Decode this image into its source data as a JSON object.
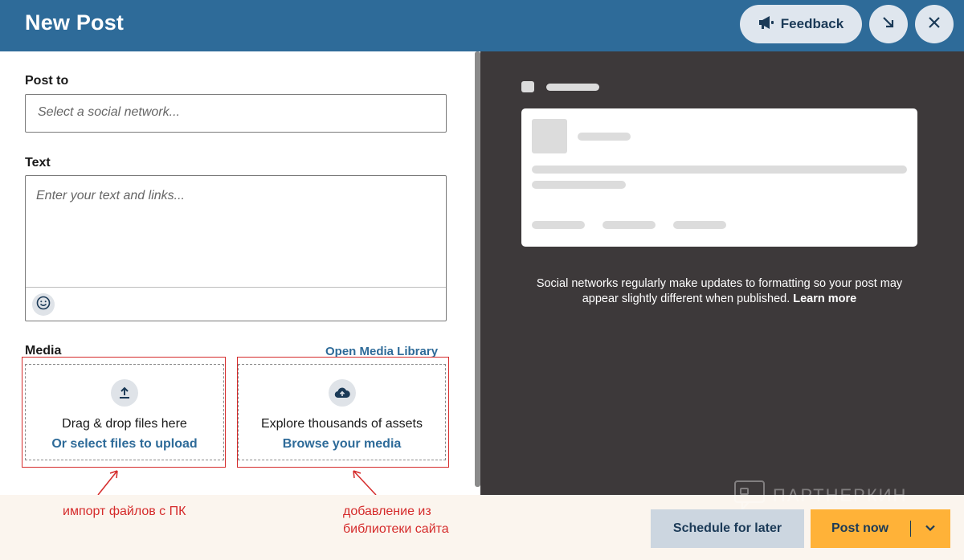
{
  "header": {
    "title": "New Post",
    "feedback_label": "Feedback",
    "bg_color": "#2e6b99"
  },
  "compose": {
    "post_to_label": "Post to",
    "network_placeholder": "Select a social network...",
    "text_label": "Text",
    "text_placeholder": "Enter your text and links...",
    "media_label": "Media",
    "media_library_link": "Open Media Library",
    "upload_zone": {
      "text": "Drag & drop files here",
      "link": "Or select files to upload",
      "icon": "upload-icon"
    },
    "browse_zone": {
      "text": "Explore thousands of assets",
      "link": "Browse your media",
      "icon": "cloud-upload-icon"
    }
  },
  "annotations": {
    "left_note": "импорт файлов с ПК",
    "right_note_line1": "добавление из",
    "right_note_line2": "библиотеки сайта",
    "color": "#d52b2b"
  },
  "preview": {
    "note_text": "Social networks regularly make updates to formatting so your post may appear slightly different when published.",
    "learn_more": "Learn more"
  },
  "footer": {
    "schedule_label": "Schedule for later",
    "post_now_label": "Post now",
    "accent_color": "#ffb238"
  },
  "watermark": {
    "text": "ПАРТНЕРКИН"
  }
}
